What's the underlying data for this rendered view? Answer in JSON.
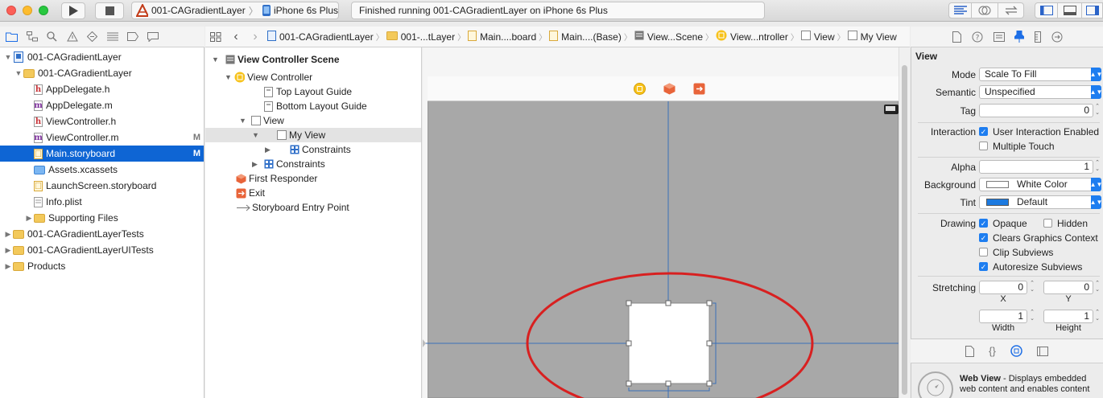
{
  "toolbar": {
    "scheme_name": "001-CAGradientLayer",
    "device_name": "iPhone 6s Plus",
    "status_text": "Finished running 001-CAGradientLayer on iPhone 6s Plus"
  },
  "navigator": {
    "items": [
      {
        "label": "001-CAGradientLayer",
        "kind": "project",
        "disclosure": "▼",
        "badge": ""
      },
      {
        "label": "001-CAGradientLayer",
        "kind": "folder",
        "disclosure": "▼",
        "badge": ""
      },
      {
        "label": "AppDelegate.h",
        "kind": "h",
        "disclosure": "",
        "badge": ""
      },
      {
        "label": "AppDelegate.m",
        "kind": "m",
        "disclosure": "",
        "badge": ""
      },
      {
        "label": "ViewController.h",
        "kind": "h",
        "disclosure": "",
        "badge": ""
      },
      {
        "label": "ViewController.m",
        "kind": "m",
        "disclosure": "",
        "badge": "M"
      },
      {
        "label": "Main.storyboard",
        "kind": "storyboard",
        "disclosure": "",
        "badge": "M",
        "selected": true
      },
      {
        "label": "Assets.xcassets",
        "kind": "assets",
        "disclosure": "",
        "badge": ""
      },
      {
        "label": "LaunchScreen.storyboard",
        "kind": "storyboard",
        "disclosure": "",
        "badge": ""
      },
      {
        "label": "Info.plist",
        "kind": "plist",
        "disclosure": "",
        "badge": ""
      },
      {
        "label": "Supporting Files",
        "kind": "folder",
        "disclosure": "▶",
        "badge": ""
      },
      {
        "label": "001-CAGradientLayerTests",
        "kind": "folder",
        "disclosure": "▶",
        "badge": ""
      },
      {
        "label": "001-CAGradientLayerUITests",
        "kind": "folder",
        "disclosure": "▶",
        "badge": ""
      },
      {
        "label": "Products",
        "kind": "folder",
        "disclosure": "▶",
        "badge": ""
      }
    ]
  },
  "jumpbar": {
    "crumbs": [
      "001-CAGradientLayer",
      "001-...tLayer",
      "Main....board",
      "Main....(Base)",
      "View...Scene",
      "View...ntroller",
      "View",
      "My View"
    ]
  },
  "outline": {
    "items": [
      {
        "label": "View Controller Scene",
        "bold": true
      },
      {
        "label": "View Controller"
      },
      {
        "label": "Top Layout Guide"
      },
      {
        "label": "Bottom Layout Guide"
      },
      {
        "label": "View"
      },
      {
        "label": "My View",
        "highlighted": true
      },
      {
        "label": "Constraints"
      },
      {
        "label": "Constraints"
      },
      {
        "label": "First Responder"
      },
      {
        "label": "Exit"
      },
      {
        "label": "Storyboard Entry Point"
      }
    ]
  },
  "inspector": {
    "section_title": "View",
    "mode_label": "Mode",
    "mode_value": "Scale To Fill",
    "semantic_label": "Semantic",
    "semantic_value": "Unspecified",
    "tag_label": "Tag",
    "tag_value": "0",
    "interaction_label": "Interaction",
    "user_interaction_label": "User Interaction Enabled",
    "user_interaction_checked": true,
    "multiple_touch_label": "Multiple Touch",
    "multiple_touch_checked": false,
    "alpha_label": "Alpha",
    "alpha_value": "1",
    "background_label": "Background",
    "background_value": "White Color",
    "background_swatch": "#ffffff",
    "tint_label": "Tint",
    "tint_value": "Default",
    "tint_swatch": "#1c7ae0",
    "drawing_label": "Drawing",
    "opaque_label": "Opaque",
    "opaque_checked": true,
    "hidden_label": "Hidden",
    "hidden_checked": false,
    "clears_label": "Clears Graphics Context",
    "clears_checked": true,
    "clip_label": "Clip Subviews",
    "clip_checked": false,
    "autoresize_label": "Autoresize Subviews",
    "autoresize_checked": true,
    "stretching_label": "Stretching",
    "stretch_x": "0",
    "stretch_y": "0",
    "stretch_w": "1",
    "stretch_h": "1",
    "x_label": "X",
    "y_label": "Y",
    "width_label": "Width",
    "height_label": "Height",
    "library_title": "Web View",
    "library_desc": " - Displays embedded web content and enables content"
  },
  "colors": {
    "selection": "#0e65d4",
    "annotation_ellipse": "#d82020",
    "guide_line": "#3a6fb8"
  }
}
